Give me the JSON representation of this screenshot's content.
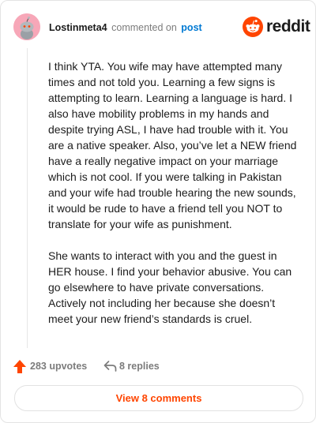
{
  "comment": {
    "username": "Lostinmeta4",
    "action_text": "commented on",
    "post_link": "post",
    "paragraphs": [
      "I think YTA. You wife may have attempted many times and not told you. Learning a few signs is attempting to learn. Learning a language is hard. I also have mobility problems in my hands and despite trying ASL, I have had trouble with it. You are a native speaker. Also, you’ve let a NEW friend have a really negative impact on your marriage which is not cool. If you were talking in Pakistan and your wife had trouble hearing the new sounds, it would be rude to have a friend tell you NOT to translate for your wife as punishment.",
      "She wants to interact with you and the guest in HER house. I find your behavior abusive. You can go elsewhere to have private conversations. Actively not including her because she doesn’t meet your new friend’s standards is cruel."
    ]
  },
  "brand": {
    "wordmark": "reddit",
    "icon": "reddit-logo-icon",
    "color": "#ff4500"
  },
  "avatar": {
    "icon": "snoo-avatar-icon",
    "color": "#f7a7b8"
  },
  "actions": {
    "upvotes_label": "283 upvotes",
    "upvote_icon": "upvote-arrow-icon",
    "upvote_color": "#ff4500",
    "replies_label": "8 replies",
    "reply_icon": "reply-arrow-icon"
  },
  "view_comments_label": "View 8 comments"
}
